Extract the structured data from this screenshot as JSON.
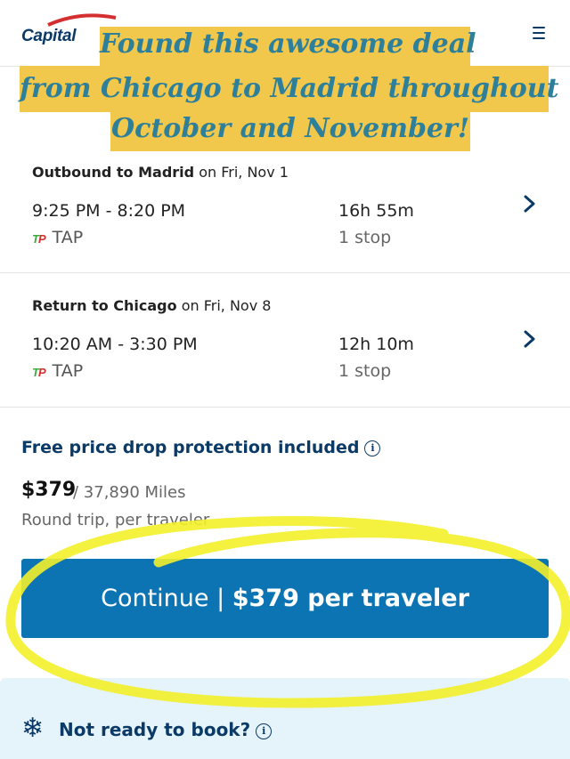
{
  "header": {
    "logo_text": "Capital",
    "menu_icon": "hamburger-menu-icon"
  },
  "banner": {
    "line1": "Found this awesome deal",
    "line2": "from Chicago to Madrid throughout",
    "line3": "October and November!"
  },
  "outbound": {
    "title_bold": "Outbound to Madrid",
    "title_rest": " on Fri, Nov 1",
    "times": "9:25 PM - 8:20 PM",
    "duration": "16h 55m",
    "airline": "TAP",
    "stops": "1 stop"
  },
  "return": {
    "title_bold": "Return to Chicago",
    "title_rest": " on Fri, Nov 8",
    "times": "10:20 AM - 3:30 PM",
    "duration": "12h 10m",
    "airline": "TAP",
    "stops": "1 stop"
  },
  "pricing": {
    "protection_label": "Free price drop protection included",
    "price": "$379",
    "miles": "/ 37,890 Miles",
    "note": "Round trip, per traveler"
  },
  "cta": {
    "prefix": "Continue | ",
    "bold": "$379 per traveler"
  },
  "panel": {
    "title": "Not ready to book?",
    "icon": "snowflake-icon"
  },
  "colors": {
    "brand_navy": "#0b3a66",
    "cta_blue": "#0d74b4",
    "banner_yellow": "#f1c84b",
    "banner_text": "#2e7f9a",
    "highlight": "#f3f02a"
  }
}
